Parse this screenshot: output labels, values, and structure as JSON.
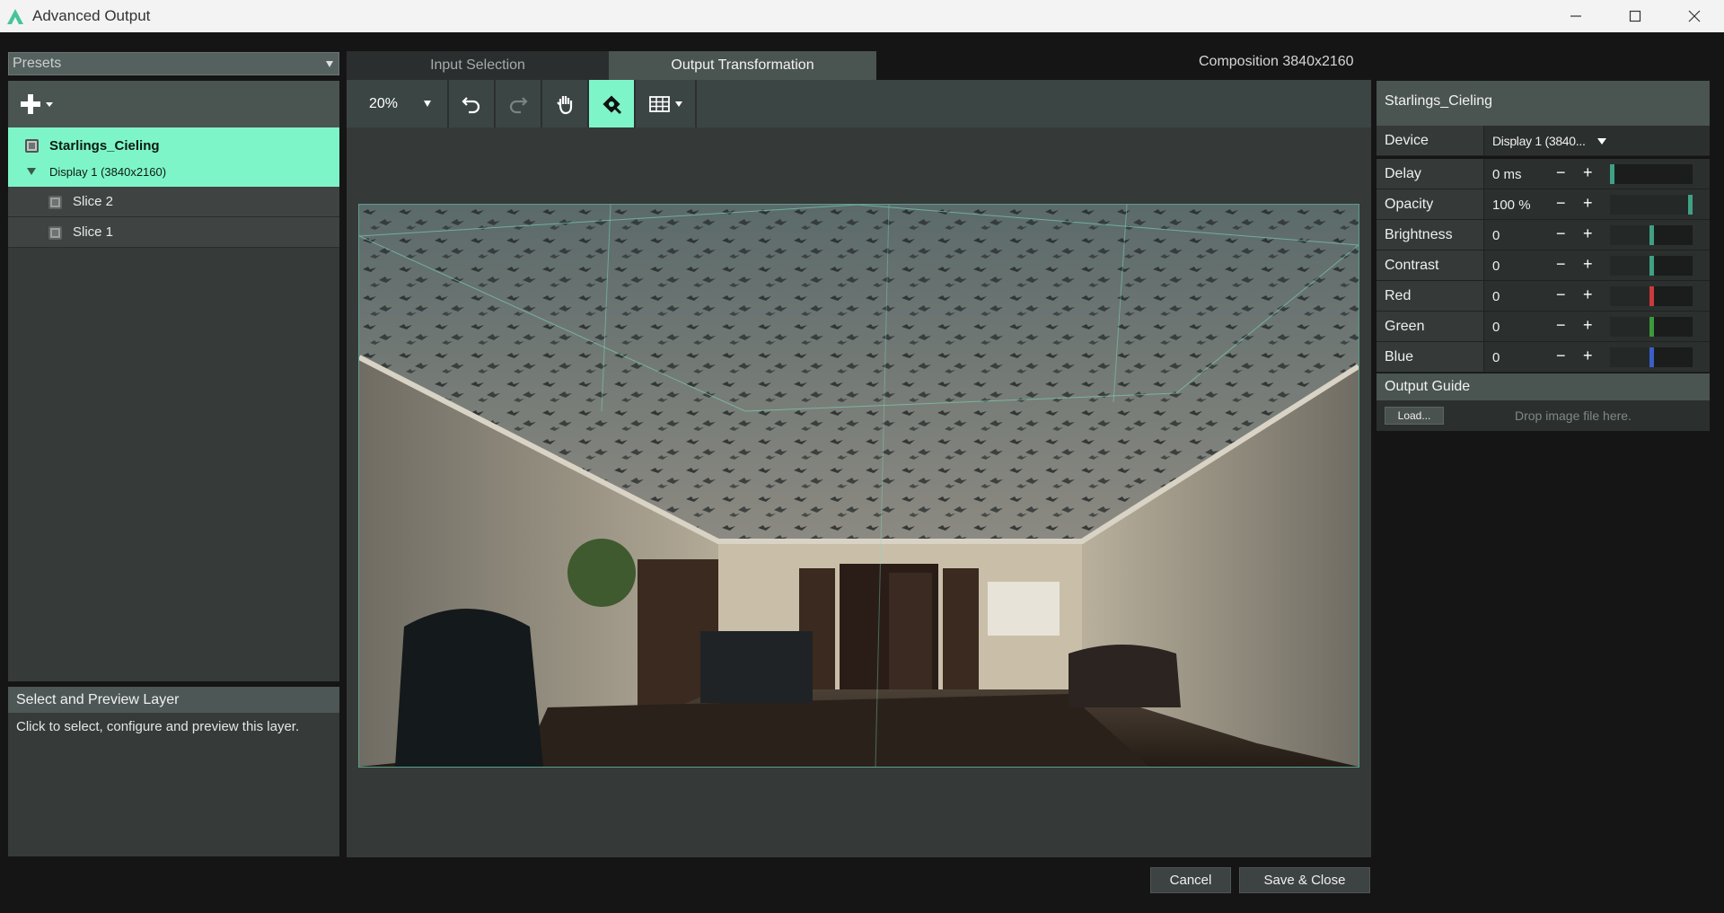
{
  "window": {
    "title": "Advanced Output"
  },
  "presets": {
    "value": "Presets"
  },
  "layers": {
    "group_name": "Starlings_Cieling",
    "group_subtitle": "Display 1 (3840x2160)",
    "slices": [
      "Slice 2",
      "Slice 1"
    ]
  },
  "info": {
    "title": "Select and Preview Layer",
    "description": "Click to select, configure and preview this layer."
  },
  "tabs": [
    {
      "label": "Input Selection",
      "active": false
    },
    {
      "label": "Output Transformation",
      "active": true
    }
  ],
  "composition_label": "Composition 3840x2160",
  "toolbar": {
    "zoom": "20%",
    "icons": [
      "undo-icon",
      "redo-icon",
      "hand-icon",
      "snap-icon",
      "grid-icon"
    ]
  },
  "properties": {
    "title": "Starlings_Cieling",
    "device_label": "Device",
    "device_value": "Display 1 (3840...",
    "rows": [
      {
        "label": "Delay",
        "value": "0 ms",
        "level": 0.0,
        "color": "#3fa085"
      },
      {
        "label": "Opacity",
        "value": "100 %",
        "level": 1.0,
        "color": "#3fa085"
      },
      {
        "label": "Brightness",
        "value": "0",
        "level": 0.5,
        "color": "#3fa085"
      },
      {
        "label": "Contrast",
        "value": "0",
        "level": 0.5,
        "color": "#3fa085"
      },
      {
        "label": "Red",
        "value": "0",
        "level": 0.5,
        "color": "#cc3a3a"
      },
      {
        "label": "Green",
        "value": "0",
        "level": 0.5,
        "color": "#3b9a3b"
      },
      {
        "label": "Blue",
        "value": "0",
        "level": 0.5,
        "color": "#3a5fc8"
      }
    ],
    "minus": "−",
    "plus": "+"
  },
  "output_guide": {
    "title": "Output Guide",
    "load_label": "Load...",
    "drop_hint": "Drop image file here."
  },
  "buttons": {
    "cancel": "Cancel",
    "save_close": "Save & Close"
  },
  "colors": {
    "accent": "#7ef5c8"
  }
}
